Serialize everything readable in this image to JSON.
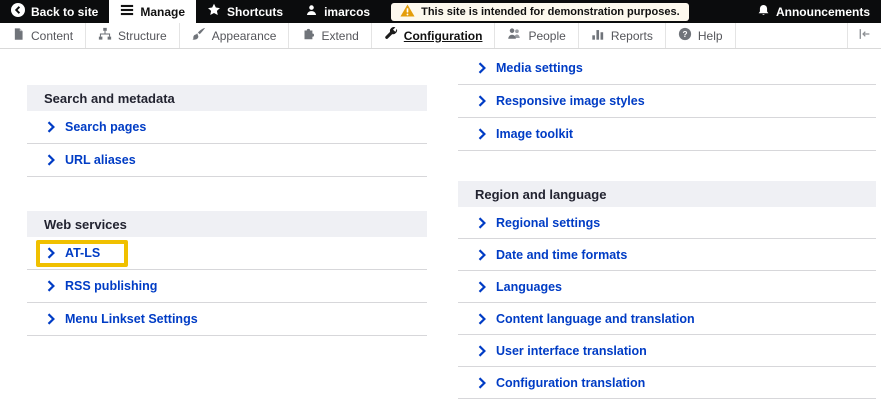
{
  "admin_toolbar": {
    "back_to_site": "Back to site",
    "manage": "Manage",
    "shortcuts": "Shortcuts",
    "user": "imarcos",
    "warning": "This site is intended for demonstration purposes.",
    "announcements": "Announcements"
  },
  "menu_bar": {
    "items": [
      {
        "label": "Content",
        "icon": "file-icon"
      },
      {
        "label": "Structure",
        "icon": "sitemap-icon"
      },
      {
        "label": "Appearance",
        "icon": "brush-icon"
      },
      {
        "label": "Extend",
        "icon": "puzzle-icon"
      },
      {
        "label": "Configuration",
        "icon": "wrench-icon",
        "active": true
      },
      {
        "label": "People",
        "icon": "people-icon"
      },
      {
        "label": "Reports",
        "icon": "bar-chart-icon"
      },
      {
        "label": "Help",
        "icon": "help-icon"
      }
    ]
  },
  "panels": {
    "left": {
      "sections": [
        {
          "title": "Search and metadata",
          "links": [
            "Search pages",
            "URL aliases"
          ]
        },
        {
          "title": "Web services",
          "links": [
            "AT-LS",
            "RSS publishing",
            "Menu Linkset Settings"
          ],
          "highlighted_link": "AT-LS"
        }
      ]
    },
    "right": {
      "sections": [
        {
          "title": "",
          "links": [
            "Media settings",
            "Responsive image styles",
            "Image toolkit"
          ]
        },
        {
          "title": "Region and language",
          "links": [
            "Regional settings",
            "Date and time formats",
            "Languages",
            "Content language and translation",
            "User interface translation",
            "Configuration translation"
          ]
        }
      ]
    }
  },
  "colors": {
    "link_blue": "#003cc5",
    "highlight_yellow": "#f0c000",
    "section_header_bg": "#eff0f4",
    "admin_toolbar_bg": "#0b0c0d",
    "warning_badge_bg": "#fdf9ee",
    "warning_icon": "#e49e0b"
  }
}
